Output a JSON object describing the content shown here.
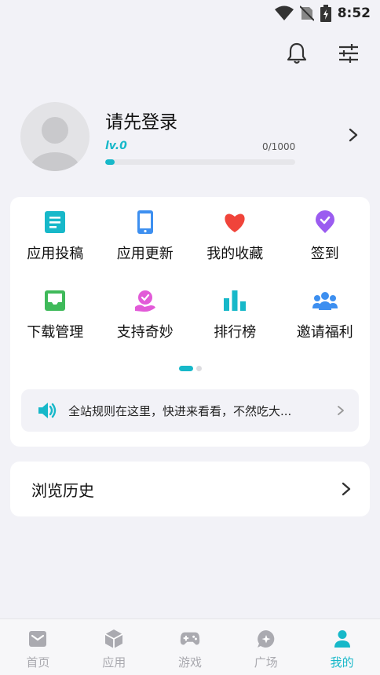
{
  "status_bar": {
    "time": "8:52"
  },
  "profile": {
    "title": "请先登录",
    "level": "lv.0",
    "exp": "0/1000",
    "progress": 0.0
  },
  "grid": [
    {
      "name": "app-submit",
      "label": "应用投稿",
      "icon": "document-icon",
      "color": "#17b8c9"
    },
    {
      "name": "app-update",
      "label": "应用更新",
      "icon": "phone-icon",
      "color": "#3d8ff0"
    },
    {
      "name": "my-favorites",
      "label": "我的收藏",
      "icon": "heart-icon",
      "color": "#f0443a"
    },
    {
      "name": "check-in",
      "label": "签到",
      "icon": "checkmark-badge-icon",
      "color": "#9b5cf0"
    },
    {
      "name": "download-manager",
      "label": "下载管理",
      "icon": "inbox-icon",
      "color": "#3fba5a"
    },
    {
      "name": "support",
      "label": "支持奇妙",
      "icon": "donate-icon",
      "color": "#e25ad8"
    },
    {
      "name": "ranking",
      "label": "排行榜",
      "icon": "bar-chart-icon",
      "color": "#17b8c9"
    },
    {
      "name": "invite",
      "label": "邀请福利",
      "icon": "people-icon",
      "color": "#3d8ff0"
    }
  ],
  "notice": {
    "text": "全站规则在这里，快进来看看，不然吃大..."
  },
  "history": {
    "title": "浏览历史"
  },
  "nav": [
    {
      "label": "首页",
      "icon": "mail-icon",
      "active": false
    },
    {
      "label": "应用",
      "icon": "cube-icon",
      "active": false
    },
    {
      "label": "游戏",
      "icon": "gamepad-icon",
      "active": false
    },
    {
      "label": "广场",
      "icon": "chat-icon",
      "active": false
    },
    {
      "label": "我的",
      "icon": "person-icon",
      "active": true
    }
  ],
  "colors": {
    "accent": "#17b8c9",
    "inactive": "#aaaab0"
  }
}
